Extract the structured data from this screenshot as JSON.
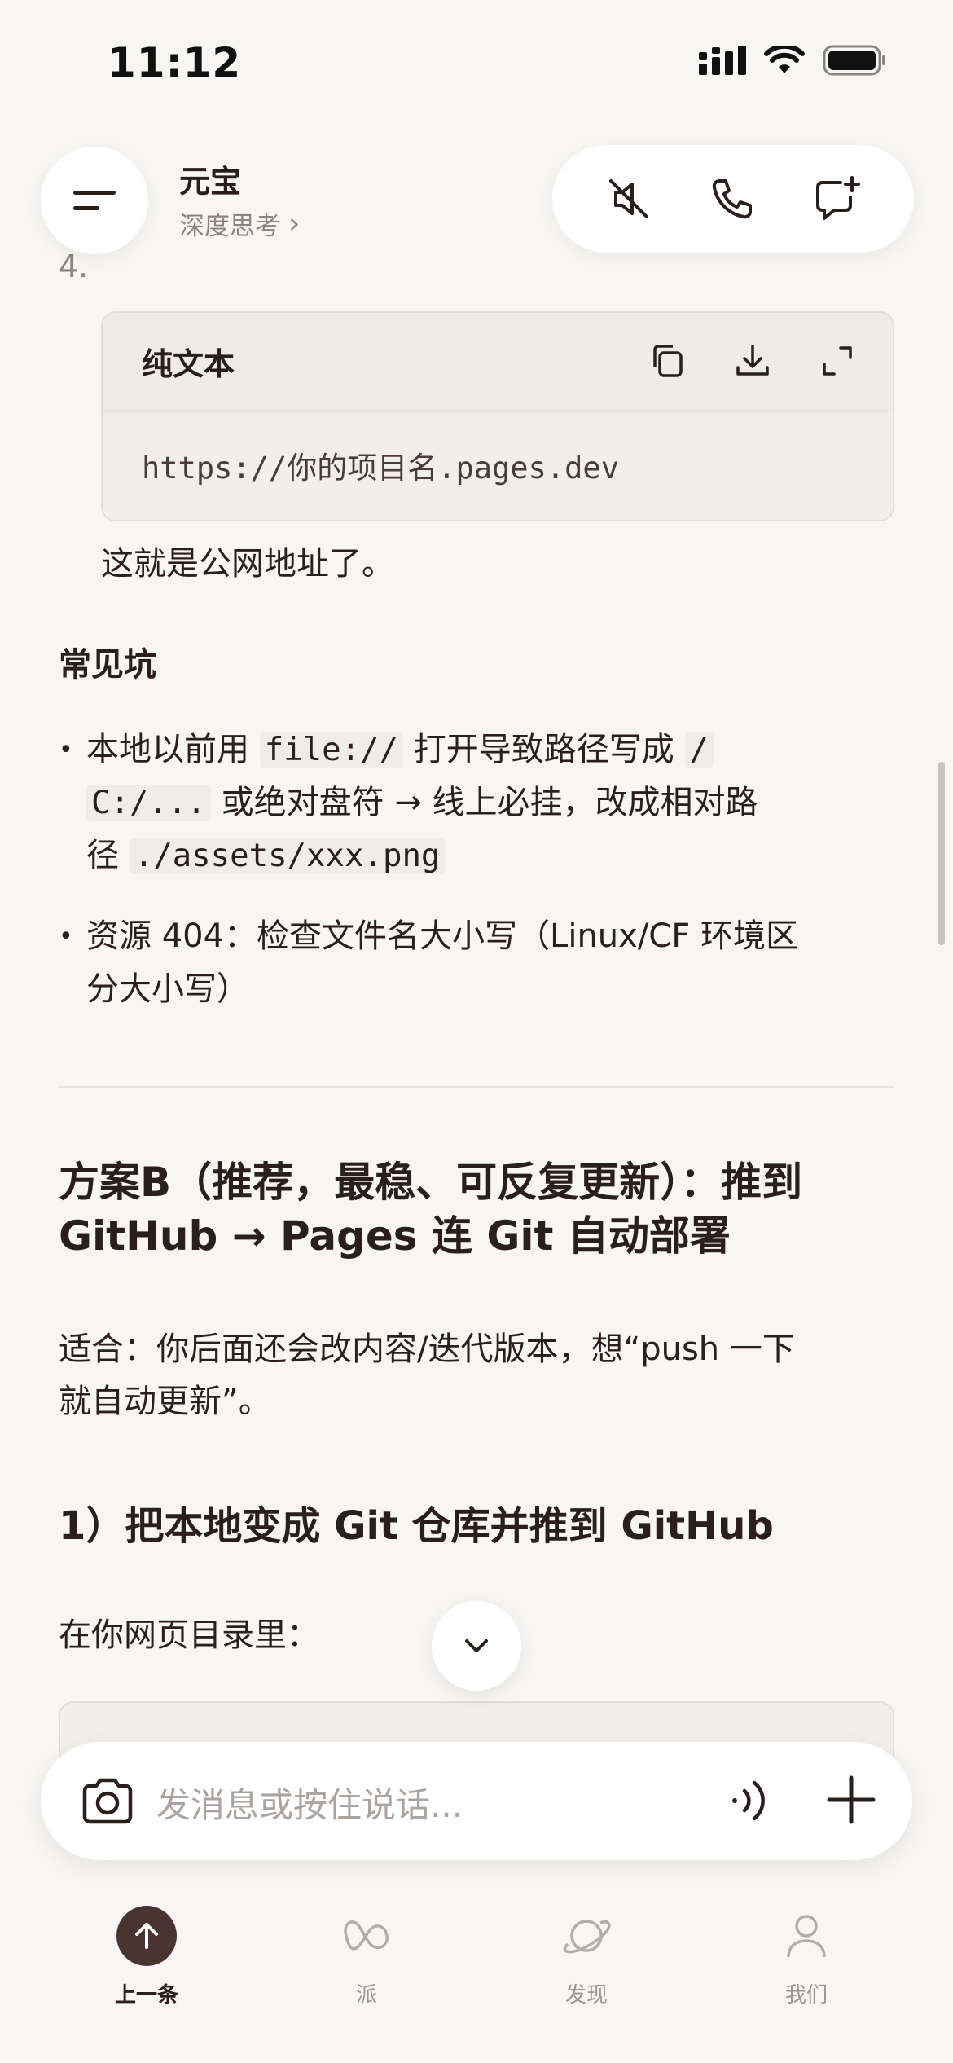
{
  "status": {
    "time": "11:12"
  },
  "header": {
    "name": "元宝",
    "mode": "深度思考",
    "chevron": "›"
  },
  "content": {
    "list_number": "4.",
    "code_block_1": {
      "language": "纯文本",
      "code": "https://你的项目名.pages.dev"
    },
    "after_code": "这就是公网地址了。",
    "pitfalls_title": "常见坑",
    "bullet_1": {
      "pre": "本地以前用 ",
      "code_a": "file://",
      "mid": " 打开导致路径写成 ",
      "code_b": "/",
      "code_c": "C:/...",
      "mid2": " 或绝对盘符 → 线上必挂，改成相对路",
      "pre2": "径 ",
      "code_d": "./assets/xxx.png"
    },
    "bullet_2": {
      "line1": "资源 404：检查文件名大小写（Linux/CF 环境区",
      "line2": "分大小写）"
    },
    "plan_b_title_line1": "方案B（推荐，最稳、可反复更新）：推到",
    "plan_b_title_line2": "GitHub → Pages 连 Git 自动部署",
    "suit_line1": "适合：你后面还会改内容/迭代版本，想“push 一下",
    "suit_line2": "就自动更新”。",
    "step1_title": "1）把本地变成 Git 仓库并推到 GitHub",
    "in_dir": "在你网页目录里："
  },
  "input": {
    "placeholder": "发消息或按住说话..."
  },
  "tabs": [
    {
      "label": "上一条",
      "icon": "arrow-up-icon",
      "active": true
    },
    {
      "label": "派",
      "icon": "infinity-icon",
      "active": false
    },
    {
      "label": "发现",
      "icon": "planet-icon",
      "active": false
    },
    {
      "label": "我们",
      "icon": "person-icon",
      "active": false
    }
  ],
  "colors": {
    "background": "#f8f6f3",
    "text": "#2b1f1b",
    "accent": "#4a3432",
    "muted": "#8d847f"
  }
}
